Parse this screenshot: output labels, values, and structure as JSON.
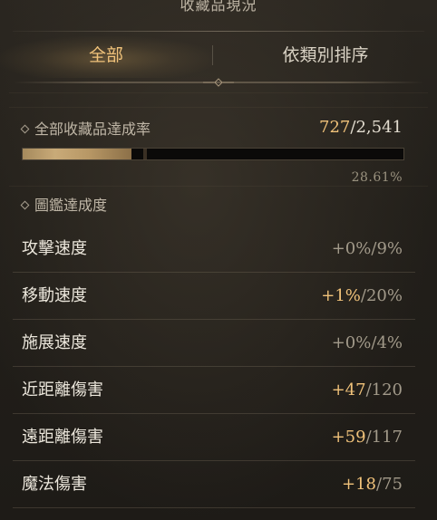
{
  "title": "收藏品現況",
  "tabs": [
    {
      "label": "全部",
      "active": true
    },
    {
      "label": "依類別排序",
      "active": false
    }
  ],
  "overall": {
    "label": "全部收藏品達成率",
    "current": "727",
    "separator": "/",
    "total": "2,541",
    "percent_text": "28.61%",
    "progress_fraction": 0.2861
  },
  "encyclopedia": {
    "label": "圖鑑達成度",
    "rows": [
      {
        "label": "攻擊速度",
        "bonus": "+0%",
        "max": "9%",
        "gain": false
      },
      {
        "label": "移動速度",
        "bonus": "+1%",
        "max": "20%",
        "gain": true
      },
      {
        "label": "施展速度",
        "bonus": "+0%",
        "max": "4%",
        "gain": false
      },
      {
        "label": "近距離傷害",
        "bonus": "+47",
        "max": "120",
        "gain": true
      },
      {
        "label": "遠距離傷害",
        "bonus": "+59",
        "max": "117",
        "gain": true
      },
      {
        "label": "魔法傷害",
        "bonus": "+18",
        "max": "75",
        "gain": true
      }
    ]
  },
  "colors": {
    "accent_gold": "#f0c27a",
    "muted_text": "#a29a8a",
    "background": "#221f1a"
  },
  "icons": {
    "section_marker": "diamond-icon"
  }
}
